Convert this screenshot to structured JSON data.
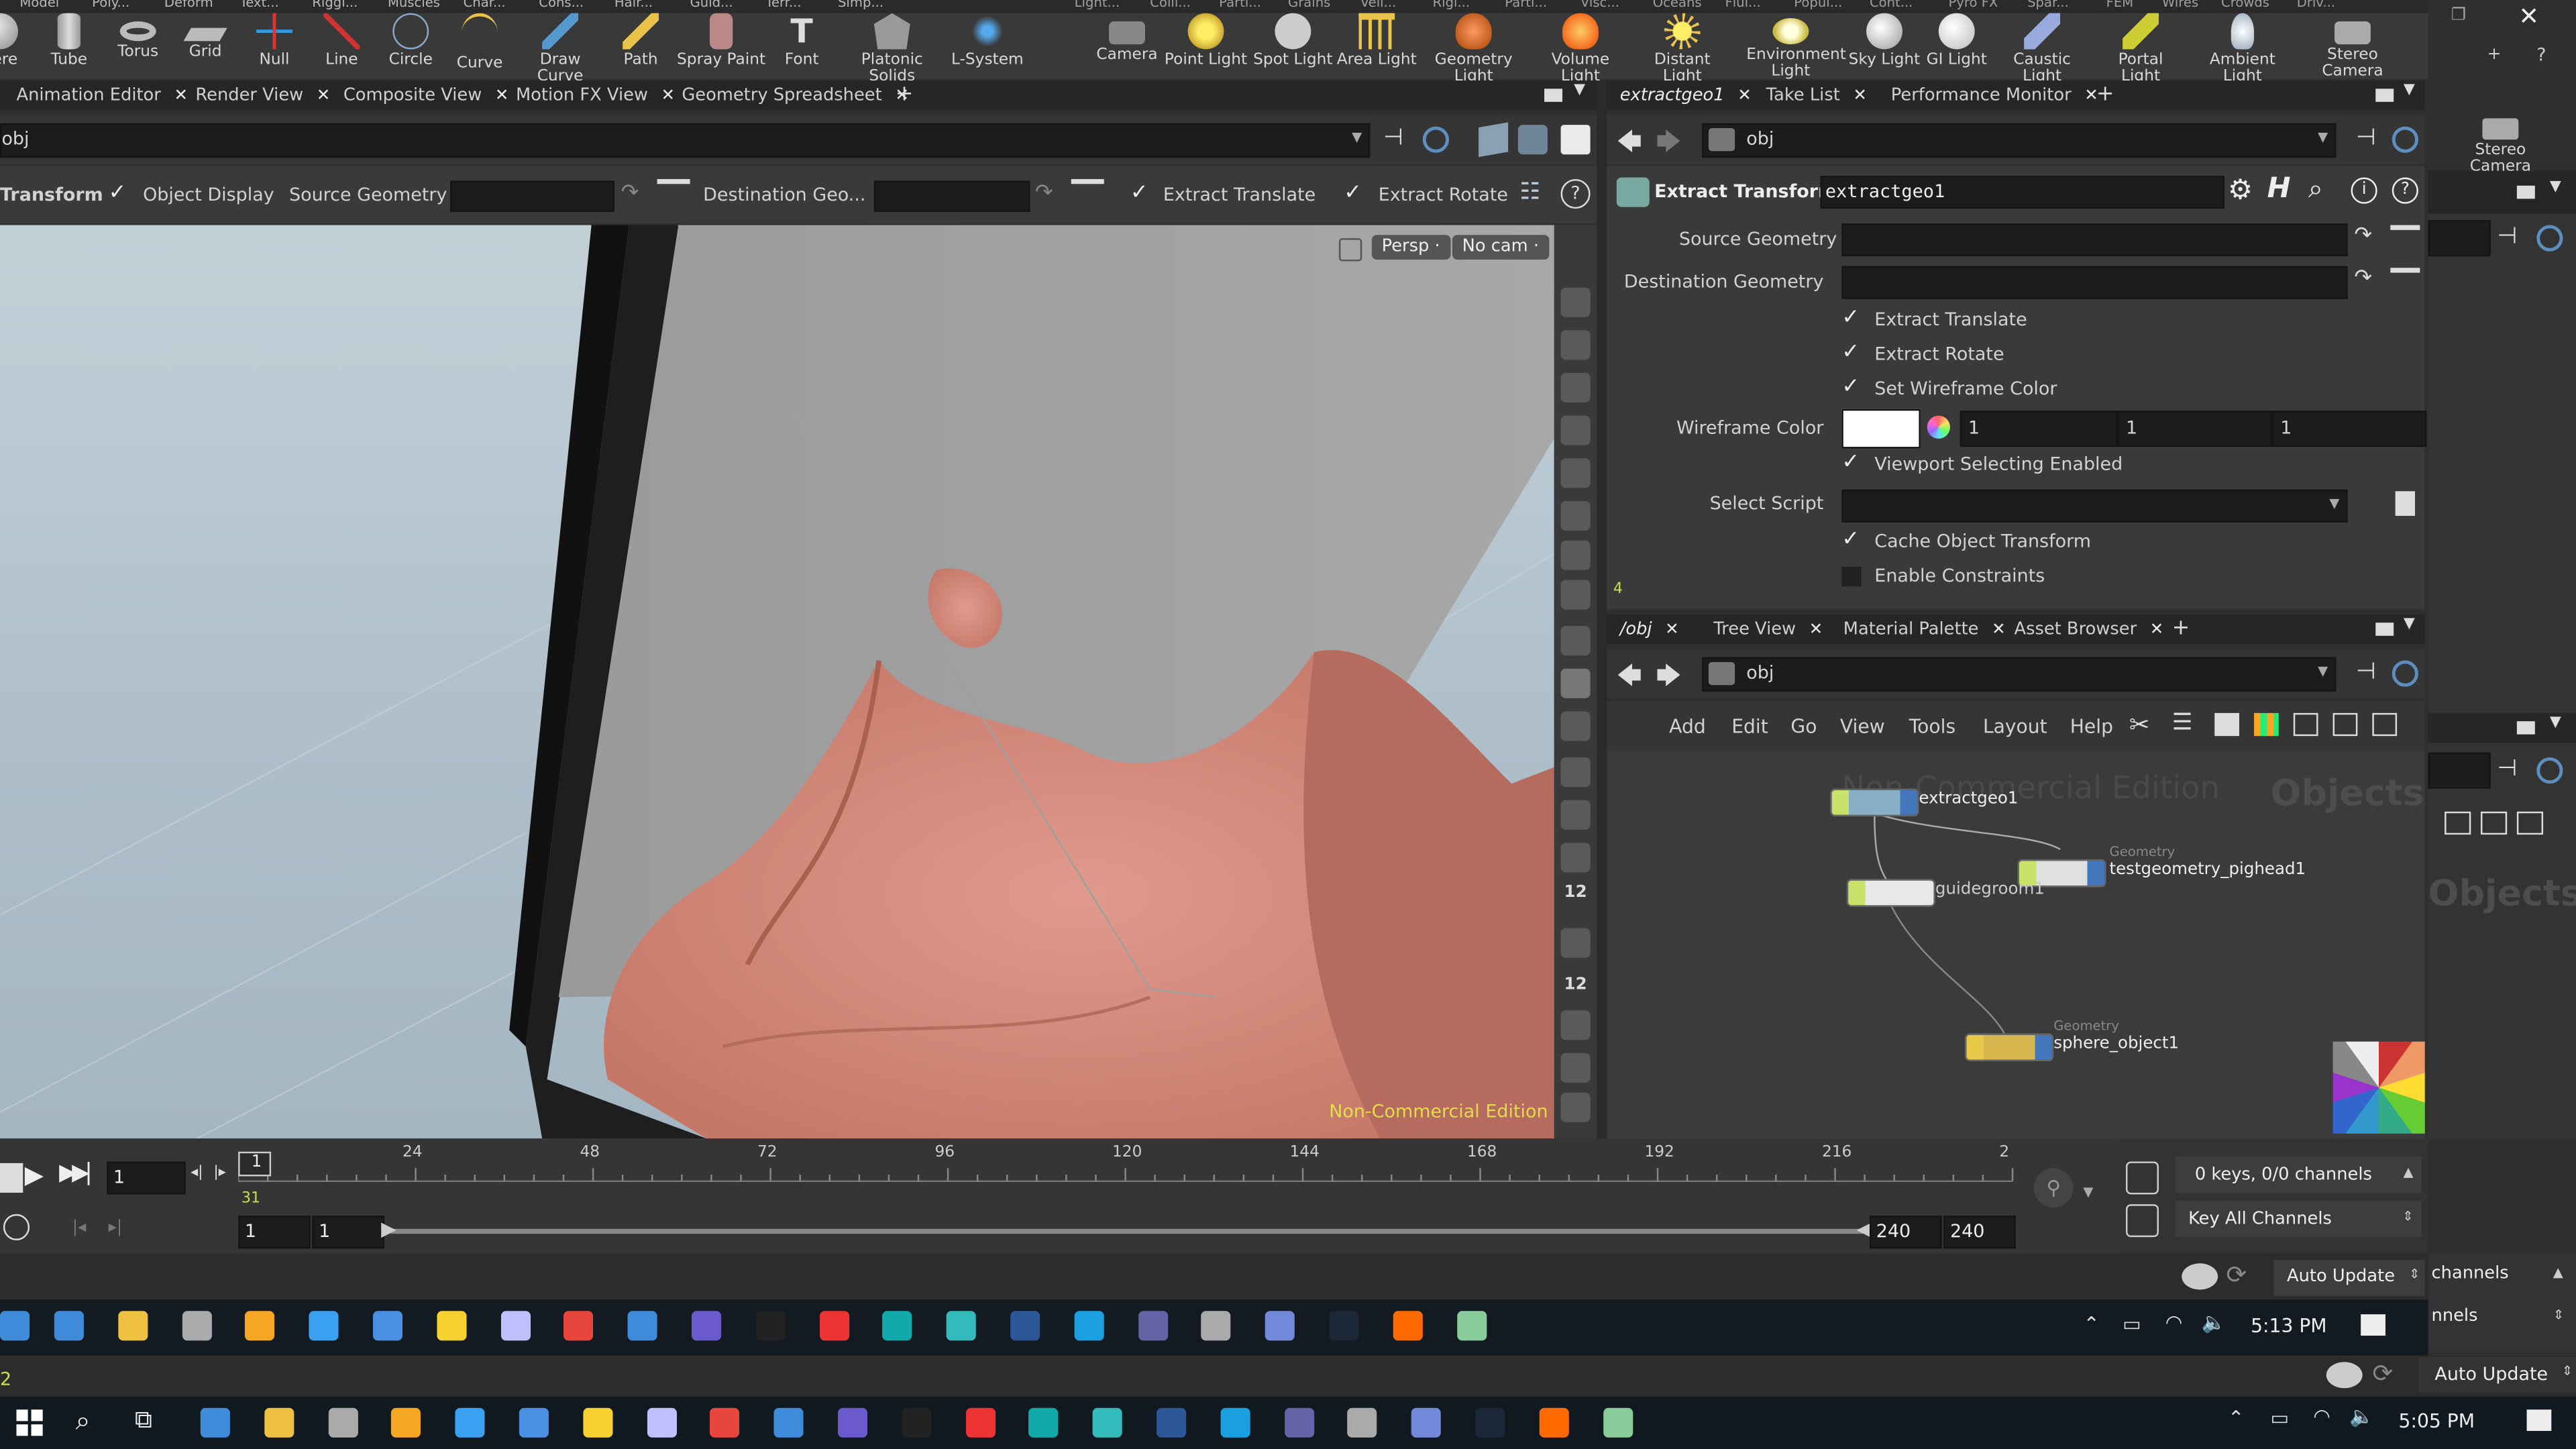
{
  "shelf_tabs": [
    "Model",
    "Poly...",
    "Deform",
    "Text...",
    "Riggi...",
    "Muscles",
    "Char...",
    "Cons...",
    "Hair...",
    "Guid...",
    "Terr...",
    "Simp...",
    "Light...",
    "Colli...",
    "Parti...",
    "Grains",
    "Vell...",
    "Rigi...",
    "Parti...",
    "Visc...",
    "Oceans",
    "Flui...",
    "Popul...",
    "Cont...",
    "Pyro FX",
    "Spar...",
    "FEM",
    "Wires",
    "Crowds",
    "Driv..."
  ],
  "shelf_tools_left": [
    {
      "label": "here",
      "icon": "sphere-icon"
    },
    {
      "label": "Tube",
      "icon": "tube-icon"
    },
    {
      "label": "Torus",
      "icon": "torus-icon"
    },
    {
      "label": "Grid",
      "icon": "grid-icon"
    },
    {
      "label": "Null",
      "icon": "null-icon"
    },
    {
      "label": "Line",
      "icon": "line-icon"
    },
    {
      "label": "Circle",
      "icon": "circle-icon"
    },
    {
      "label": "Curve",
      "icon": "curve-icon"
    },
    {
      "label": "Draw Curve",
      "icon": "draw-curve-icon"
    },
    {
      "label": "Path",
      "icon": "path-icon"
    },
    {
      "label": "Spray Paint",
      "icon": "spray-paint-icon"
    },
    {
      "label": "Font",
      "icon": "font-icon"
    },
    {
      "label": "Platonic Solids",
      "icon": "platonic-solids-icon"
    },
    {
      "label": "L-System",
      "icon": "l-system-icon"
    }
  ],
  "shelf_tools_right": [
    {
      "label": "Camera",
      "icon": "camera-icon"
    },
    {
      "label": "Point Light",
      "icon": "point-light-icon"
    },
    {
      "label": "Spot Light",
      "icon": "spot-light-icon"
    },
    {
      "label": "Area Light",
      "icon": "area-light-icon"
    },
    {
      "label": "Geometry Light",
      "icon": "geometry-light-icon"
    },
    {
      "label": "Volume Light",
      "icon": "volume-light-icon"
    },
    {
      "label": "Distant Light",
      "icon": "distant-light-icon"
    },
    {
      "label": "Environment Light",
      "icon": "environment-light-icon"
    },
    {
      "label": "Sky Light",
      "icon": "sky-light-icon"
    },
    {
      "label": "GI Light",
      "icon": "gi-light-icon"
    },
    {
      "label": "Caustic Light",
      "icon": "caustic-light-icon"
    },
    {
      "label": "Portal Light",
      "icon": "portal-light-icon"
    },
    {
      "label": "Ambient Light",
      "icon": "ambient-light-icon"
    },
    {
      "label": "Stereo Camera",
      "icon": "stereo-camera-icon"
    }
  ],
  "left_tabs": [
    "Animation Editor",
    "Render View",
    "Composite View",
    "Motion FX View",
    "Geometry Spreadsheet"
  ],
  "left_path": "obj",
  "operator_bar": {
    "title": "Transform",
    "object_display": "Object Display",
    "source_geometry": "Source Geometry",
    "destination_geometry": "Destination Geo...",
    "extract_translate": "Extract Translate",
    "extract_rotate": "Extract Rotate"
  },
  "viewport": {
    "persp": "Persp",
    "cam": "No cam",
    "watermark": "Non-Commercial Edition"
  },
  "viewport_tool_numbers": [
    "12",
    "12"
  ],
  "params_tabs": [
    "extractgeo1",
    "Take List",
    "Performance Monitor"
  ],
  "params_path": "obj",
  "node_header": {
    "type": "Extract Transform",
    "name": "extractgeo1"
  },
  "params": {
    "source_geometry": "Source Geometry",
    "destination_geometry": "Destination Geometry",
    "extract_translate": "Extract Translate",
    "extract_rotate": "Extract Rotate",
    "set_wireframe_color": "Set Wireframe Color",
    "wireframe_color_label": "Wireframe Color",
    "wireframe_values": [
      "1",
      "1",
      "1"
    ],
    "viewport_selecting": "Viewport Selecting Enabled",
    "select_script": "Select Script",
    "cache_object_transform": "Cache Object Transform",
    "enable_constraints": "Enable Constraints",
    "corner_digit": "4"
  },
  "network_tabs": [
    "/obj",
    "Tree View",
    "Material Palette",
    "Asset Browser"
  ],
  "network_path": "obj",
  "network_menu": [
    "Add",
    "Edit",
    "Go",
    "View",
    "Tools",
    "Layout",
    "Help"
  ],
  "network": {
    "watermark": "Non-Commercial Edition",
    "objects_label": "Objects",
    "nodes": [
      {
        "name": "extractgeo1",
        "type": ""
      },
      {
        "name": "testgeometry_pighead1",
        "type": "Geometry"
      },
      {
        "name": "guidegroom1",
        "type": ""
      },
      {
        "name": "sphere_object1",
        "type": "Geometry"
      }
    ]
  },
  "far_right": {
    "tab": "Driv...",
    "stereo": "Stereo Camera",
    "objects": "Objects",
    "channels": "channels",
    "nels": "nnels",
    "auto_update": "Auto Update"
  },
  "timeline": {
    "frame": "1",
    "ticks": [
      "24",
      "48",
      "72",
      "96",
      "120",
      "144",
      "168",
      "192",
      "216",
      "2"
    ],
    "marker": "31",
    "start": "1",
    "start2": "1",
    "end": "240",
    "end2": "240",
    "keys": "0 keys, 0/0 channels",
    "key_all": "Key All Channels",
    "auto_update": "Auto Update"
  },
  "taskbar_inner": {
    "time": "5:13 PM"
  },
  "status_digit": "2",
  "bottom_auto_update": "Auto Update",
  "taskbar_outer": {
    "time": "5:05 PM"
  },
  "colors": {
    "accent": "#ffcc22",
    "node_green": "#c8e26a",
    "node_yellow": "#e8c84a",
    "viewport_bg": "#b7c8d2",
    "skin": "#d98e80"
  }
}
